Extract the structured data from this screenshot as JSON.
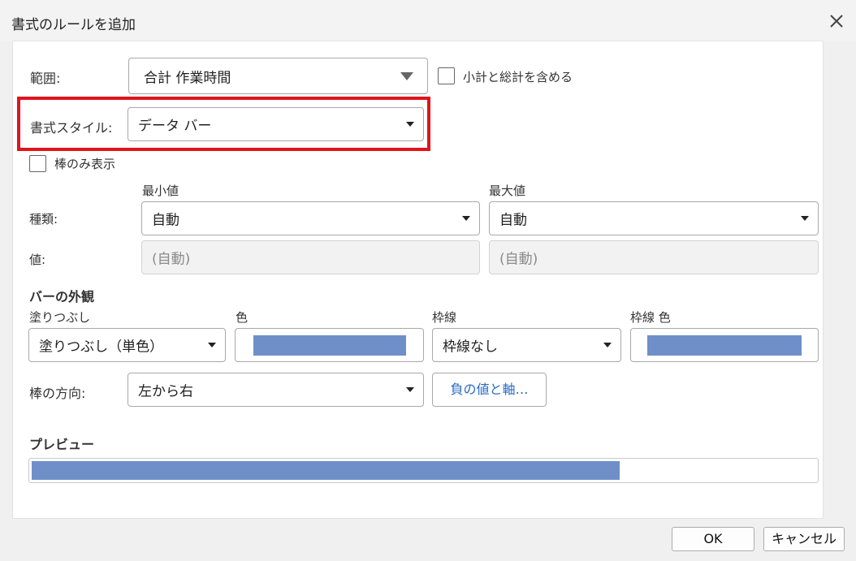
{
  "dialog": {
    "title": "書式のルールを追加"
  },
  "range": {
    "label": "範囲:",
    "value": "合計 作業時間",
    "include_subtotals": "小計と総計を含める"
  },
  "format_style": {
    "label": "書式スタイル:",
    "value": "データ バー"
  },
  "show_bar_only": "棒のみ表示",
  "min": {
    "header": "最小値",
    "type": "自動",
    "value": "(自動)"
  },
  "max": {
    "header": "最大値",
    "type": "自動",
    "value": "(自動)"
  },
  "type_label": "種類:",
  "value_label": "値:",
  "appearance": {
    "heading": "バーの外観",
    "fill_label": "塗りつぶし",
    "fill_value": "塗りつぶし（単色）",
    "color_label": "色",
    "fill_color": "#6f8fc8",
    "border_label": "枠線",
    "border_value": "枠線なし",
    "border_color_label": "枠線 色",
    "border_color": "#6f8fc8"
  },
  "direction": {
    "label": "棒の方向:",
    "value": "左から右"
  },
  "negative_button": "負の値と軸…",
  "preview": {
    "heading": "プレビュー",
    "fill_fraction": 0.75,
    "bar_color": "#6f8fc8"
  },
  "buttons": {
    "ok": "OK",
    "cancel": "キャンセル"
  },
  "colors": {
    "highlight": "#e0141e",
    "link": "#2b6cc4"
  }
}
